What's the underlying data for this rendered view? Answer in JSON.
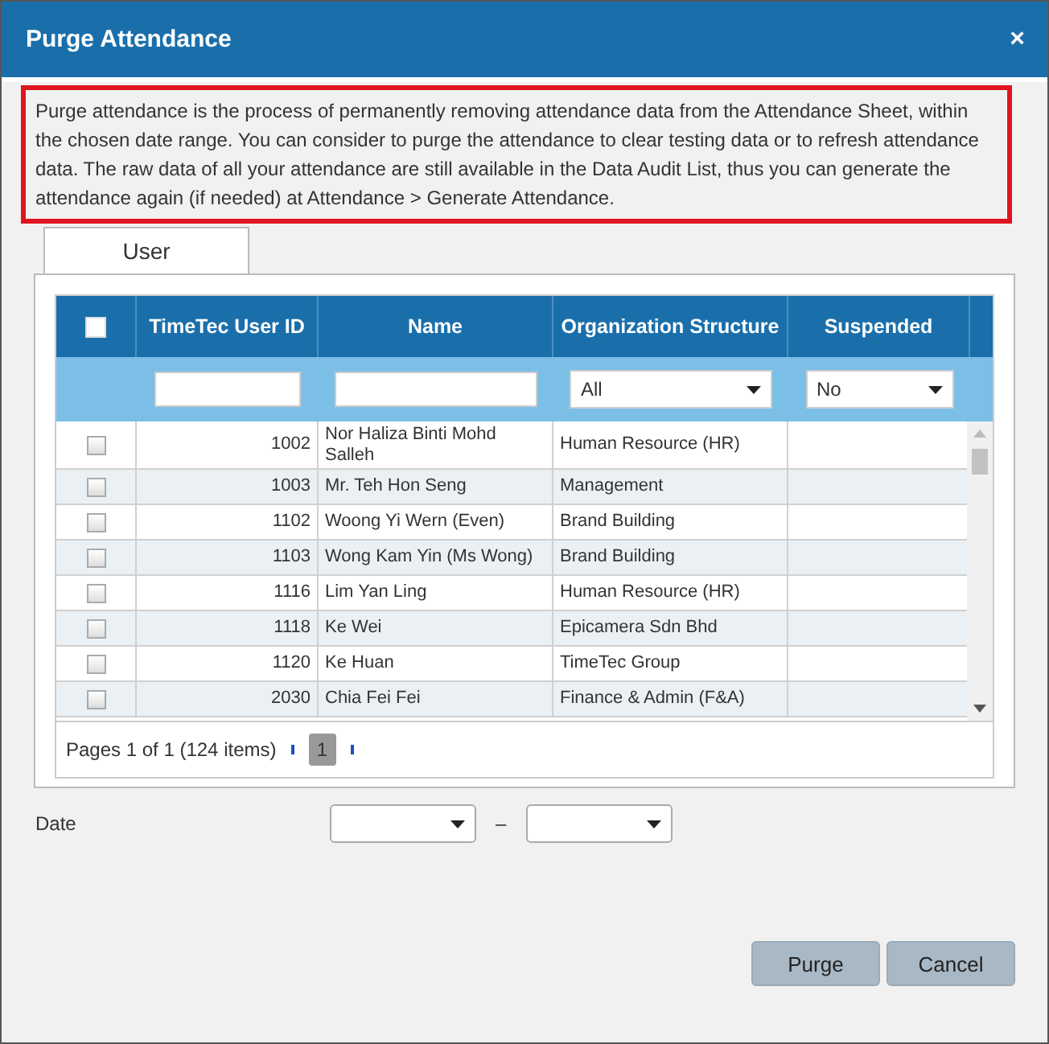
{
  "window": {
    "title": "Purge Attendance",
    "close": "×"
  },
  "notice": "Purge attendance is the process of permanently removing attendance data from the Attendance Sheet, within the chosen date range. You can consider to purge the attendance to clear testing data or to refresh attendance data. The raw data of all your attendance are still available in the Data Audit List, thus you can generate the attendance again (if needed) at Attendance > Generate Attendance.",
  "tabs": [
    {
      "label": "User",
      "selected": true
    }
  ],
  "table": {
    "select_all": {
      "checked": false
    },
    "columns": [
      "TimeTec User ID",
      "Name",
      "Organization Structure",
      "Suspended"
    ],
    "filters": [
      {
        "kind": "text"
      },
      {
        "kind": "text"
      },
      {
        "kind": "select",
        "value": "All"
      },
      {
        "kind": "select",
        "value": "No"
      }
    ],
    "rows": [
      {
        "checked": false,
        "user_id": "1002",
        "name": "Nor Haliza Binti Mohd Salleh",
        "organization": "Human Resource (HR)"
      },
      {
        "checked": false,
        "user_id": "1003",
        "name": "Mr. Teh Hon Seng",
        "organization": "Management"
      },
      {
        "checked": false,
        "user_id": "1102",
        "name": "Woong Yi Wern (Even)",
        "organization": "Brand Building"
      },
      {
        "checked": false,
        "user_id": "1103",
        "name": "Wong Kam Yin (Ms Wong)",
        "organization": "Brand Building"
      },
      {
        "checked": false,
        "user_id": "1116",
        "name": "Lim Yan Ling",
        "organization": "Human Resource (HR)"
      },
      {
        "checked": false,
        "user_id": "1118",
        "name": "Ke Wei",
        "organization": "Epicamera Sdn Bhd"
      },
      {
        "checked": false,
        "user_id": "1120",
        "name": "Ke Huan",
        "organization": "TimeTec Group"
      },
      {
        "checked": false,
        "user_id": "2030",
        "name": "Chia Fei Fei",
        "organization": "Finance & Admin (F&A)"
      }
    ],
    "pager": {
      "summary": "Pages 1 of 1 (124 items)",
      "pages": [
        {
          "label": "1",
          "selected": true
        }
      ]
    }
  },
  "date": {
    "label": "Date",
    "separator": "–"
  },
  "buttons": [
    {
      "label": "Purge"
    },
    {
      "label": "Cancel"
    }
  ]
}
